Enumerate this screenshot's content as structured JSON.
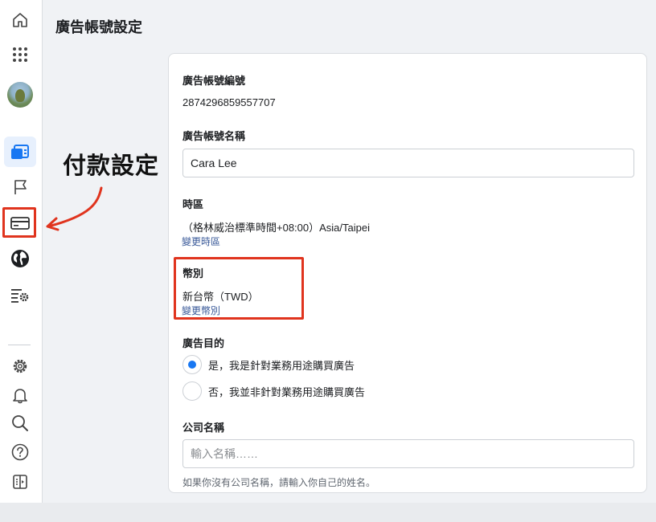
{
  "page": {
    "title": "廣告帳號設定"
  },
  "annotation": {
    "text": "付款設定"
  },
  "sidebar": {
    "items": [
      {
        "name": "home",
        "icon": "home-icon"
      },
      {
        "name": "apps",
        "icon": "grid-icon"
      },
      {
        "name": "profile",
        "icon": "avatar"
      },
      {
        "name": "ads-manager",
        "icon": "ads-manager-icon",
        "active": true
      },
      {
        "name": "pages",
        "icon": "flag-icon"
      },
      {
        "name": "billing",
        "icon": "credit-card-icon"
      },
      {
        "name": "audience",
        "icon": "globe-icon"
      },
      {
        "name": "settings-list",
        "icon": "list-settings-icon"
      },
      {
        "name": "settings",
        "icon": "gear-icon"
      },
      {
        "name": "notifications",
        "icon": "bell-icon"
      },
      {
        "name": "search",
        "icon": "search-icon"
      },
      {
        "name": "help",
        "icon": "help-icon"
      },
      {
        "name": "panel",
        "icon": "panel-toggle-icon"
      }
    ]
  },
  "form": {
    "account_id_label": "廣告帳號編號",
    "account_id_value": "2874296859557707",
    "account_name_label": "廣告帳號名稱",
    "account_name_value": "Cara Lee",
    "timezone_label": "時區",
    "timezone_value": "（格林威治標準時間+08:00）Asia/Taipei",
    "timezone_link": "變更時區",
    "currency_label": "幣別",
    "currency_value": "新台幣（TWD）",
    "currency_link": "變更幣別",
    "purpose_label": "廣告目的",
    "purpose_options": [
      {
        "label": "是，我是針對業務用途購買廣告",
        "selected": true
      },
      {
        "label": "否，我並非針對業務用途購買廣告",
        "selected": false
      }
    ],
    "company_label": "公司名稱",
    "company_placeholder": "輸入名稱……",
    "company_hint": "如果你沒有公司名稱，請輸入你自己的姓名。"
  },
  "colors": {
    "accent": "#1877f2",
    "link": "#385898",
    "highlight": "#e0341e"
  }
}
